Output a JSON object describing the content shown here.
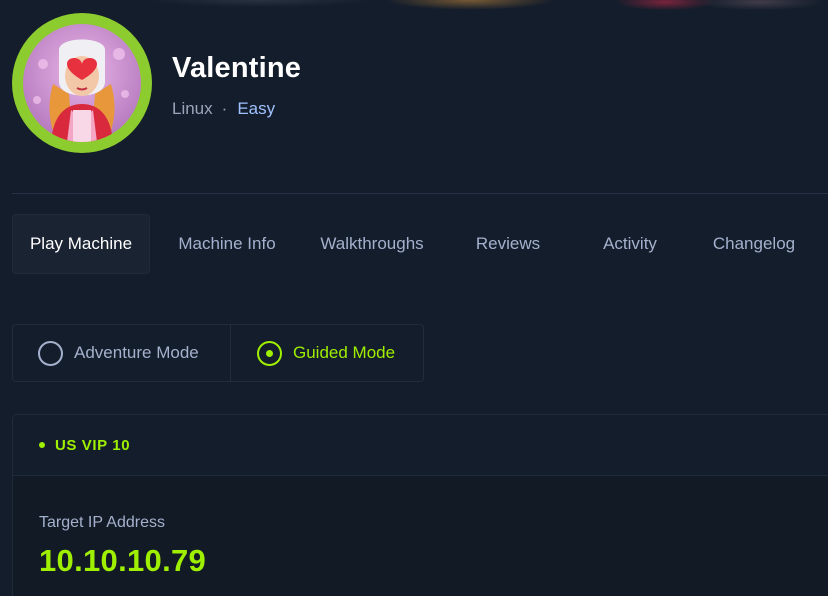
{
  "machine": {
    "name": "Valentine",
    "os": "Linux",
    "separator": "·",
    "difficulty": "Easy"
  },
  "tabs": [
    {
      "label": "Play Machine",
      "active": true
    },
    {
      "label": "Machine Info",
      "active": false
    },
    {
      "label": "Walkthroughs",
      "active": false
    },
    {
      "label": "Reviews",
      "active": false
    },
    {
      "label": "Activity",
      "active": false
    },
    {
      "label": "Changelog",
      "active": false
    }
  ],
  "modes": {
    "adventure_label": "Adventure Mode",
    "guided_label": "Guided Mode",
    "selected": "Guided Mode"
  },
  "server": {
    "name": "US VIP 10",
    "status": "online"
  },
  "target": {
    "label": "Target IP Address",
    "ip": "10.10.10.79"
  },
  "colors": {
    "accent": "#9fef00",
    "background": "#141d2b",
    "muted_text": "#a4b1cd",
    "difficulty": "#9fc2ff",
    "avatar_ring": "#8ccc2f"
  }
}
